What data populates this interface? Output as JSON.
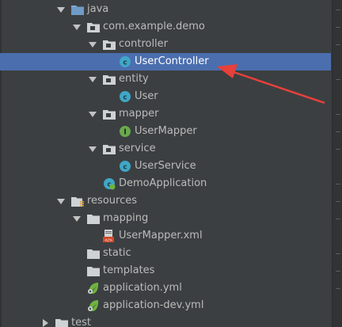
{
  "tree": {
    "items": [
      {
        "label": "java",
        "icon": "folder-source-icon",
        "toggle": "down"
      },
      {
        "label": "com.example.demo",
        "icon": "package-icon",
        "toggle": "down"
      },
      {
        "label": "controller",
        "icon": "package-icon",
        "toggle": "down"
      },
      {
        "label": "UserController",
        "icon": "class-icon",
        "toggle": "none",
        "selected": true
      },
      {
        "label": "entity",
        "icon": "package-icon",
        "toggle": "down"
      },
      {
        "label": "User",
        "icon": "class-icon",
        "toggle": "none"
      },
      {
        "label": "mapper",
        "icon": "package-icon",
        "toggle": "down"
      },
      {
        "label": "UserMapper",
        "icon": "interface-icon",
        "toggle": "none"
      },
      {
        "label": "service",
        "icon": "package-icon",
        "toggle": "down"
      },
      {
        "label": "UserService",
        "icon": "class-icon",
        "toggle": "none"
      },
      {
        "label": "DemoApplication",
        "icon": "spring-boot-class-icon",
        "toggle": "none"
      },
      {
        "label": "resources",
        "icon": "resources-folder-icon",
        "toggle": "down"
      },
      {
        "label": "mapping",
        "icon": "folder-icon",
        "toggle": "down"
      },
      {
        "label": "UserMapper.xml",
        "icon": "xml-file-icon",
        "toggle": "none"
      },
      {
        "label": "static",
        "icon": "folder-icon",
        "toggle": "none"
      },
      {
        "label": "templates",
        "icon": "folder-icon",
        "toggle": "none"
      },
      {
        "label": "application.yml",
        "icon": "spring-yml-icon",
        "toggle": "none"
      },
      {
        "label": "application-dev.yml",
        "icon": "spring-yml-icon",
        "toggle": "none"
      },
      {
        "label": "test",
        "icon": "folder-icon",
        "toggle": "right"
      }
    ]
  },
  "colors": {
    "background": "#3c3f41",
    "selection": "#4b6eaf",
    "text": "#bbbbbb",
    "annotation_arrow": "#e8403a"
  }
}
